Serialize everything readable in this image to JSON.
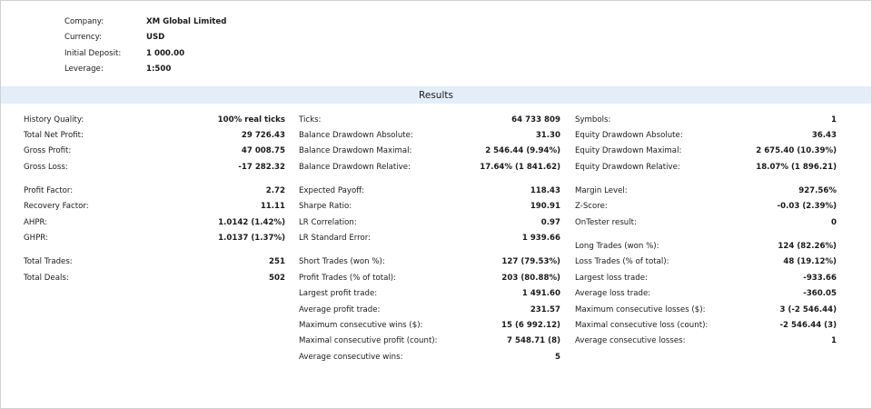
{
  "info": [
    {
      "label": "Company:",
      "value": "XM Global Limited"
    },
    {
      "label": "Currency:",
      "value": "USD"
    },
    {
      "label": "Initial Deposit:",
      "value": "1 000.00"
    },
    {
      "label": "Leverage:",
      "value": "1:500"
    }
  ],
  "results_title": "Results",
  "columns": [
    [
      [
        {
          "label": "History Quality:",
          "value": "100% real ticks"
        },
        {
          "label": "Total Net Profit:",
          "value": "29 726.43"
        },
        {
          "label": "Gross Profit:",
          "value": "47 008.75"
        },
        {
          "label": "Gross Loss:",
          "value": "-17 282.32"
        }
      ],
      [
        {
          "label": "Profit Factor:",
          "value": "2.72"
        },
        {
          "label": "Recovery Factor:",
          "value": "11.11"
        },
        {
          "label": "AHPR:",
          "value": "1.0142 (1.42%)"
        },
        {
          "label": "GHPR:",
          "value": "1.0137 (1.37%)"
        }
      ],
      [
        {
          "label": "Total Trades:",
          "value": "251"
        },
        {
          "label": "Total Deals:",
          "value": "502"
        }
      ]
    ],
    [
      [
        {
          "label": "Ticks:",
          "value": "64 733 809"
        },
        {
          "label": "Balance Drawdown Absolute:",
          "value": "31.30"
        },
        {
          "label": "Balance Drawdown Maximal:",
          "value": "2 546.44 (9.94%)"
        },
        {
          "label": "Balance Drawdown Relative:",
          "value": "17.64% (1 841.62)"
        }
      ],
      [
        {
          "label": "Expected Payoff:",
          "value": "118.43"
        },
        {
          "label": "Sharpe Ratio:",
          "value": "190.91"
        },
        {
          "label": "LR Correlation:",
          "value": "0.97"
        },
        {
          "label": "LR Standard Error:",
          "value": "1 939.66"
        }
      ],
      [
        {
          "label": "Short Trades (won %):",
          "value": "127 (79.53%)"
        },
        {
          "label": "Profit Trades (% of total):",
          "value": "203 (80.88%)"
        },
        {
          "label": "Largest profit trade:",
          "value": "1 491.60"
        },
        {
          "label": "Average profit trade:",
          "value": "231.57"
        },
        {
          "label": "Maximum consecutive wins ($):",
          "value": "15 (6 992.12)"
        },
        {
          "label": "Maximal consecutive profit (count):",
          "value": "7 548.71 (8)"
        },
        {
          "label": "Average consecutive wins:",
          "value": "5"
        }
      ]
    ],
    [
      [
        {
          "label": "Symbols:",
          "value": "1"
        },
        {
          "label": "Equity Drawdown Absolute:",
          "value": "36.43"
        },
        {
          "label": "Equity Drawdown Maximal:",
          "value": "2 675.40 (10.39%)"
        },
        {
          "label": "Equity Drawdown Relative:",
          "value": "18.07% (1 896.21)"
        }
      ],
      [
        {
          "label": "Margin Level:",
          "value": "927.56%"
        },
        {
          "label": "Z-Score:",
          "value": "-0.03 (2.39%)"
        },
        {
          "label": "OnTester result:",
          "value": "0"
        }
      ],
      [
        {
          "label": "Long Trades (won %):",
          "value": "124 (82.26%)"
        },
        {
          "label": "Loss Trades (% of total):",
          "value": "48 (19.12%)"
        },
        {
          "label": "Largest loss trade:",
          "value": "-933.66"
        },
        {
          "label": "Average loss trade:",
          "value": "-360.05"
        },
        {
          "label": "Maximum consecutive losses ($):",
          "value": "3 (-2 546.44)"
        },
        {
          "label": "Maximal consecutive loss (count):",
          "value": "-2 546.44 (3)"
        },
        {
          "label": "Average consecutive losses:",
          "value": "1"
        }
      ]
    ]
  ]
}
